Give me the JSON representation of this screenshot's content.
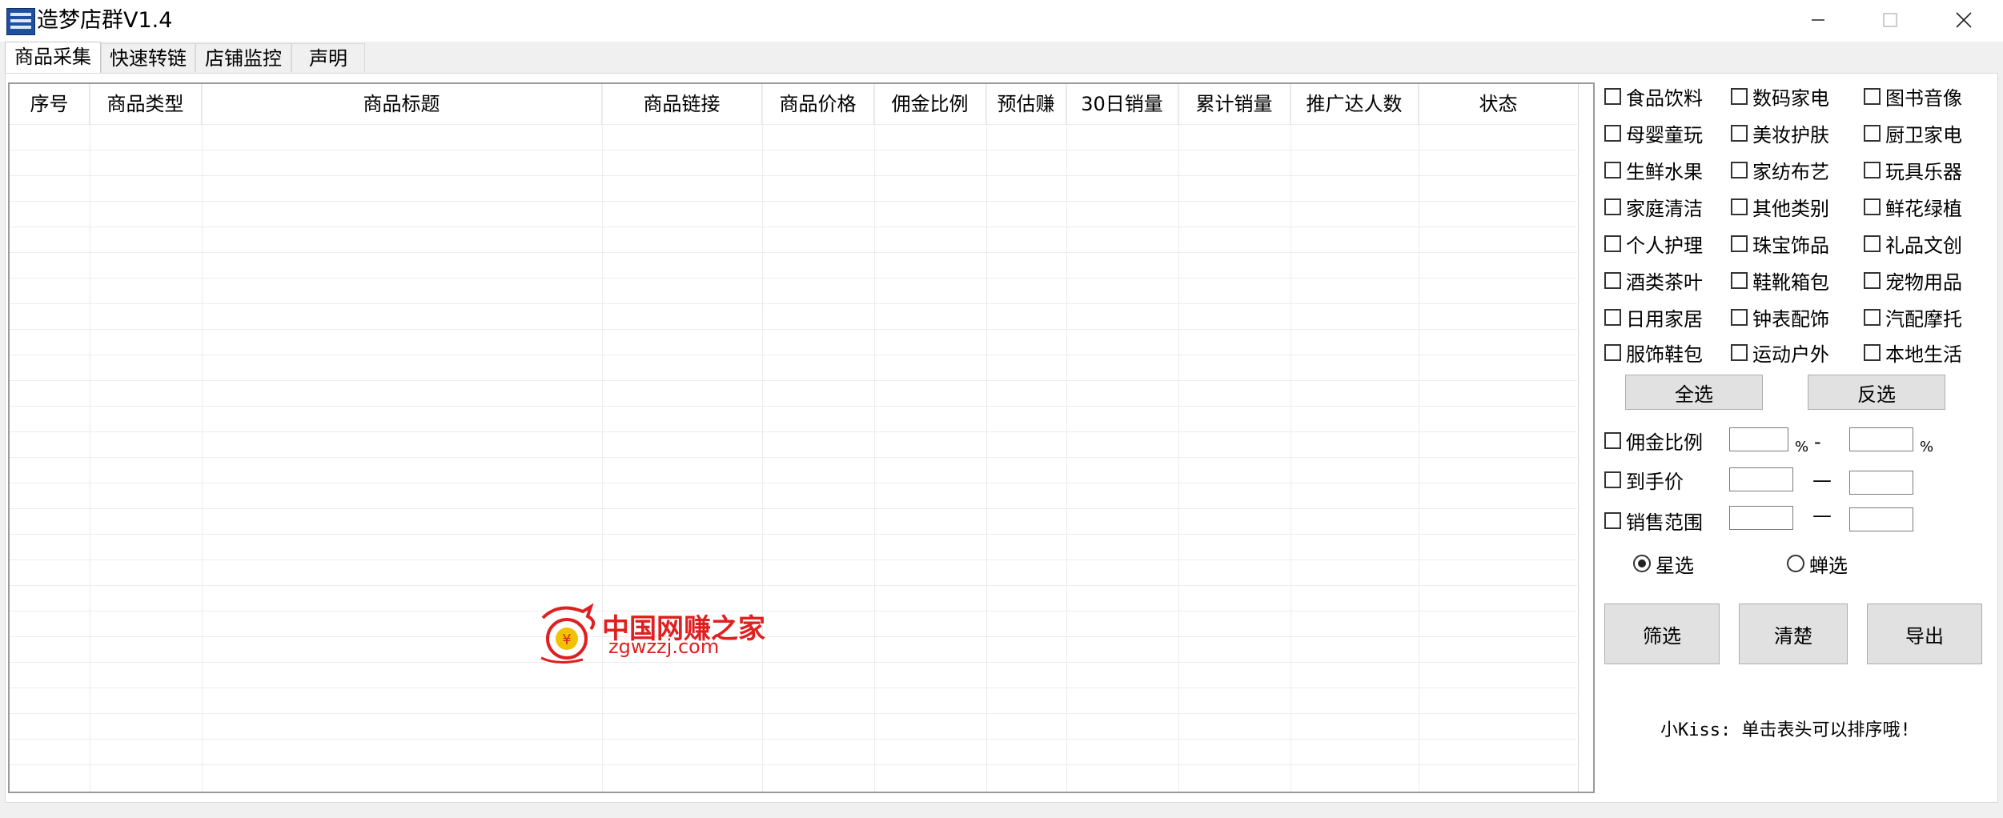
{
  "window": {
    "title": "造梦店群V1.4",
    "icon": "app-logo-icon",
    "controls": [
      "minimize-icon",
      "maximize-icon",
      "close-icon"
    ]
  },
  "tabs": [
    {
      "label": "商品采集",
      "active": true
    },
    {
      "label": "快速转链",
      "active": false
    },
    {
      "label": "店铺监控",
      "active": false
    },
    {
      "label": "声明",
      "active": false
    }
  ],
  "table": {
    "columns": [
      "序号",
      "商品类型",
      "商品标题",
      "商品链接",
      "商品价格",
      "佣金比例",
      "预估赚",
      "30日销量",
      "累计销量",
      "推广达人数",
      "状态"
    ],
    "rows": []
  },
  "categories": [
    {
      "label": "食品饮料",
      "checked": false
    },
    {
      "label": "数码家电",
      "checked": false
    },
    {
      "label": "图书音像",
      "checked": false
    },
    {
      "label": "母婴童玩",
      "checked": false
    },
    {
      "label": "美妆护肤",
      "checked": false
    },
    {
      "label": "厨卫家电",
      "checked": false
    },
    {
      "label": "生鲜水果",
      "checked": false
    },
    {
      "label": "家纺布艺",
      "checked": false
    },
    {
      "label": "玩具乐器",
      "checked": false
    },
    {
      "label": "家庭清洁",
      "checked": false
    },
    {
      "label": "其他类别",
      "checked": false
    },
    {
      "label": "鲜花绿植",
      "checked": false
    },
    {
      "label": "个人护理",
      "checked": false
    },
    {
      "label": "珠宝饰品",
      "checked": false
    },
    {
      "label": "礼品文创",
      "checked": false
    },
    {
      "label": "酒类茶叶",
      "checked": false
    },
    {
      "label": "鞋靴箱包",
      "checked": false
    },
    {
      "label": "宠物用品",
      "checked": false
    },
    {
      "label": "日用家居",
      "checked": false
    },
    {
      "label": "钟表配饰",
      "checked": false
    },
    {
      "label": "汽配摩托",
      "checked": false
    },
    {
      "label": "服饰鞋包",
      "checked": false
    },
    {
      "label": "运动户外",
      "checked": false
    },
    {
      "label": "本地生活",
      "checked": false
    }
  ],
  "select_buttons": {
    "select_all": "全选",
    "invert": "反选"
  },
  "filters": {
    "commission": {
      "label": "佣金比例",
      "checked": false,
      "min": "",
      "max": "",
      "unit": "%",
      "separator": "-"
    },
    "final_price": {
      "label": "到手价",
      "checked": false,
      "min": "",
      "max": "",
      "separator": "—"
    },
    "sales_range": {
      "label": "销售范围",
      "checked": false,
      "min": "",
      "max": "",
      "separator": "—"
    }
  },
  "selection_mode": {
    "options": [
      {
        "label": "星选",
        "checked": true
      },
      {
        "label": "蝉选",
        "checked": false
      }
    ]
  },
  "actions": {
    "filter": "筛选",
    "clear": "清楚",
    "export": "导出"
  },
  "hint": "小Kiss: 单击表头可以排序哦!",
  "watermark": {
    "cn": "中国网赚之家",
    "en": "zgwzzj.com",
    "color": "#e02020"
  }
}
